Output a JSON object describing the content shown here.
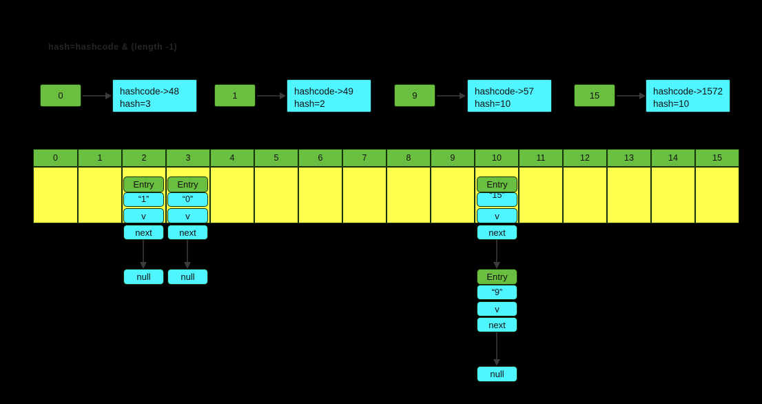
{
  "diagram": {
    "title": "hash=hashcode & (length -1)",
    "bg_color": "#000000",
    "green": "#6abf40",
    "cyan": "#50f6ff",
    "yellow": "#ffff4d",
    "stroke": "#17300a"
  },
  "hash_examples": [
    {
      "key": "0",
      "info": "hashcode->48\nhash=3"
    },
    {
      "key": "1",
      "info": "hashcode->49\nhash=2"
    },
    {
      "key": "9",
      "info": "hashcode->57\nhash=10"
    },
    {
      "key": "15",
      "info": "hashcode->1572\nhash=10"
    }
  ],
  "table": {
    "name": "hash-bucket-array",
    "indices": [
      "0",
      "1",
      "2",
      "3",
      "4",
      "5",
      "6",
      "7",
      "8",
      "9",
      "10",
      "11",
      "12",
      "13",
      "14",
      "15"
    ]
  },
  "chains": [
    {
      "bucket": "2",
      "nodes": [
        {
          "type": "entry",
          "entry_label": "Entry",
          "key": "“1”",
          "value": "v",
          "next": "next"
        },
        {
          "type": "null",
          "label": "null"
        }
      ]
    },
    {
      "bucket": "3",
      "nodes": [
        {
          "type": "entry",
          "entry_label": "Entry",
          "key": "“0”",
          "value": "v",
          "next": "next"
        },
        {
          "type": "null",
          "label": "null"
        }
      ]
    },
    {
      "bucket": "10",
      "nodes": [
        {
          "type": "entry",
          "entry_label": "Entry",
          "key": "“15”",
          "value": "v",
          "next": "next"
        },
        {
          "type": "entry",
          "entry_label": "Entry",
          "key": "“9”",
          "value": "v",
          "next": "next"
        },
        {
          "type": "null",
          "label": "null"
        }
      ]
    }
  ]
}
